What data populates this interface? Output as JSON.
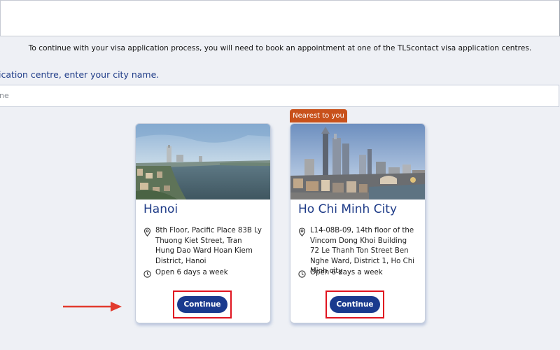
{
  "intro_text": "To continue with your visa application process, you will need to book an appointment at one of the TLScontact visa application centres.",
  "search_prompt": "ication centre, enter your city name.",
  "search": {
    "placeholder": "ne"
  },
  "centres": [
    {
      "city": "Hanoi",
      "address": "8th Floor, Pacific Place 83B Ly Thuong Kiet Street, Tran Hung Dao Ward Hoan Kiem District, Hanoi",
      "hours": "Open 6 days a week",
      "button_label": "Continue"
    },
    {
      "badge": "Nearest to you",
      "city": "Ho Chi Minh City",
      "address": "L14-08B-09, 14th floor of the Vincom Dong Khoi Building 72 Le Thanh Ton Street Ben Nghe Ward, District 1, Ho Chi Minh city",
      "hours": "Open 6 days a week",
      "button_label": "Continue"
    }
  ],
  "colors": {
    "title_blue": "#1f3c88",
    "button_blue": "#1a3a8e",
    "badge_orange": "#c8511b",
    "highlight_red": "#e0141f"
  },
  "icons": [
    "location-pin-icon",
    "clock-icon",
    "red-arrow-icon"
  ]
}
